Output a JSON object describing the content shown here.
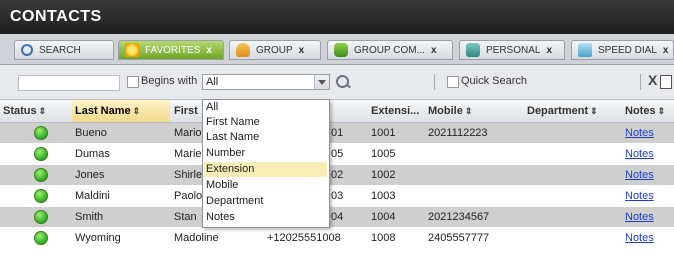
{
  "header": {
    "title": "CONTACTS"
  },
  "tabs": [
    {
      "label": "SEARCH",
      "icon": "search-icon"
    },
    {
      "label": "FAVORITES",
      "icon": "star-icon",
      "close": "x",
      "active": true
    },
    {
      "label": "GROUP",
      "icon": "group-icon",
      "close": "x"
    },
    {
      "label": "GROUP COM...",
      "icon": "group-communicator-icon",
      "close": "x"
    },
    {
      "label": "PERSONAL",
      "icon": "personal-icon",
      "close": "x"
    },
    {
      "label": "SPEED DIAL",
      "icon": "speed-dial-icon",
      "close": "x"
    }
  ],
  "toolbar": {
    "search_value": "",
    "begins_with_label": "Begins with",
    "filter_selected": "All",
    "quick_search_label": "Quick Search",
    "close_label": "X"
  },
  "filter_options": [
    "All",
    "First Name",
    "Last Name",
    "Number",
    "Extension",
    "Mobile",
    "Department",
    "Notes"
  ],
  "filter_highlighted": "Extension",
  "columns": {
    "status": "Status",
    "last_name": "Last Name",
    "first_name": "First",
    "extension": "Extensi...",
    "mobile": "Mobile",
    "department": "Department",
    "notes": "Notes"
  },
  "sort_glyph": "⇕",
  "rows": [
    {
      "last": "Bueno",
      "first": "Mario",
      "number_tail": "01",
      "ext": "1001",
      "mobile": "2021112223",
      "dept": "",
      "notes": "Notes"
    },
    {
      "last": "Dumas",
      "first": "Marie",
      "number_tail": "05",
      "ext": "1005",
      "mobile": "",
      "dept": "",
      "notes": "Notes"
    },
    {
      "last": "Jones",
      "first": "Shirley",
      "number_tail": "02",
      "ext": "1002",
      "mobile": "",
      "dept": "",
      "notes": "Notes"
    },
    {
      "last": "Maldini",
      "first": "Paolo",
      "number_tail": "03",
      "ext": "1003",
      "mobile": "",
      "dept": "",
      "notes": "Notes"
    },
    {
      "last": "Smith",
      "first": "Stan",
      "number_tail": "04",
      "ext": "1004",
      "mobile": "2021234567",
      "dept": "",
      "notes": "Notes"
    },
    {
      "last": "Wyoming",
      "first": "Madoline",
      "number_tail": "+12025551008",
      "ext": "1008",
      "mobile": "2405557777",
      "dept": "",
      "notes": "Notes"
    }
  ],
  "colors": {
    "header_bg": "#1e1e1e",
    "active_tab": "#6ea524",
    "status_online": "#27a81f",
    "row_gray": "#cfcfcf",
    "link": "#1b3fcf",
    "highlight": "#f8edb7"
  }
}
